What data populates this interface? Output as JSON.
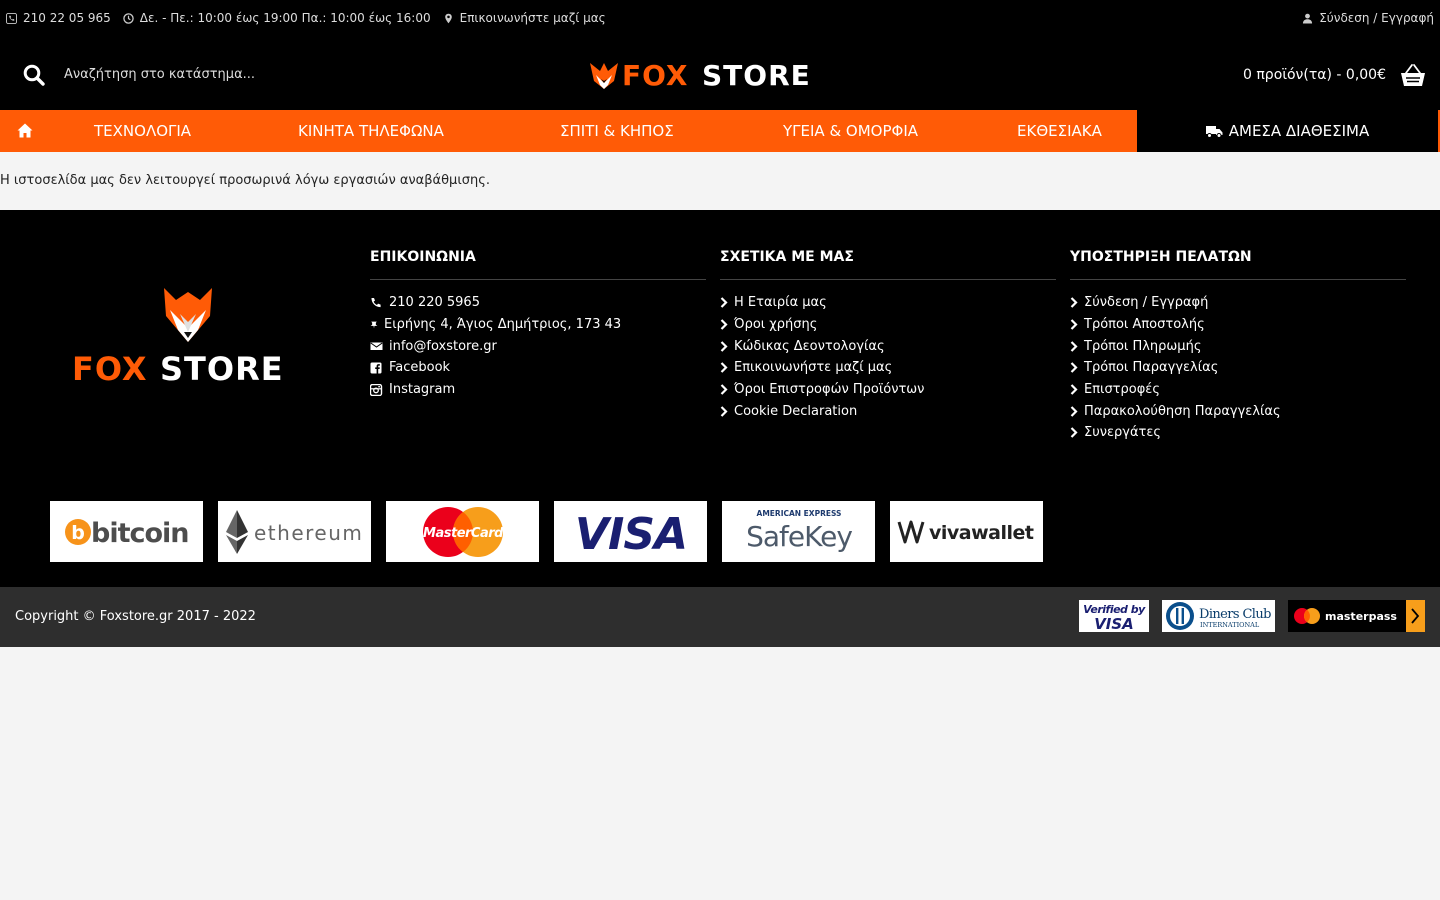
{
  "topbar": {
    "phone": "210 22 05 965",
    "hours": "Δε. - Πε.: 10:00 έως 19:00 Πα.: 10:00 έως 16:00",
    "contact": "Επικοινωνήστε μαζί μας",
    "login": "Σύνδεση / Εγγραφή"
  },
  "header": {
    "search_placeholder": "Αναζήτηση στο κατάστημα...",
    "logo_left": "FOX",
    "logo_right": "STORE",
    "cart_text": "0 προϊόν(τα) - 0,00€"
  },
  "nav": {
    "items": [
      "ΤΕΧΝΟΛΟΓΙΑ",
      "ΚΙΝΗΤΑ ΤΗΛΕΦΩΝΑ",
      "ΣΠΙΤΙ & ΚΗΠΟΣ",
      "ΥΓΕΙΑ & ΟΜΟΡΦΙΑ",
      "ΕΚΘΕΣΙΑΚΑ"
    ],
    "available": "ΑΜΕΣΑ ΔΙΑΘΕΣΙΜΑ"
  },
  "notice": "Η ιστοσελίδα μας δεν λειτουργεί προσωρινά λόγω εργασιών αναβάθμισης.",
  "footer": {
    "logo_left": "FOX",
    "logo_right": "STORE",
    "contact": {
      "title": "ΕΠΙΚΟΙΝΩΝΙΑ",
      "phone": "210 220 5965",
      "address": "Ειρήνης 4, Άγιος Δημήτριος, 173 43",
      "email": "info@foxstore.gr",
      "facebook": "Facebook",
      "instagram": "Instagram"
    },
    "about": {
      "title": "ΣΧΕΤΙΚΑ ΜΕ ΜΑΣ",
      "items": [
        "Η Εταιρία μας",
        "Όροι χρήσης",
        "Κώδικας Δεοντολογίας",
        "Επικοινωνήστε μαζί μας",
        "Όροι Επιστροφών Προϊόντων",
        "Cookie Declaration"
      ]
    },
    "support": {
      "title": "ΥΠΟΣΤΗΡΙΞΗ ΠΕΛΑΤΩΝ",
      "items": [
        "Σύνδεση / Εγγραφή",
        "Τρόποι Αποστολής",
        "Τρόποι Πληρωμής",
        "Τρόποι Παραγγελίας",
        "Επιστροφές",
        "Παρακολούθηση Παραγγελίας",
        "Συνεργάτες"
      ]
    },
    "payments": {
      "bitcoin": "bitcoin",
      "ethereum": "ethereum",
      "mastercard": "MasterCard",
      "visa": "VISA",
      "amex_top": "AMERICAN EXPRESS",
      "amex_main": "SafeKey",
      "viva": "vivawallet"
    }
  },
  "bottom": {
    "copyright": "Copyright © Foxstore.gr 2017 - 2022",
    "verified_top": "Verified by",
    "verified_main": "VISA",
    "diners_top": "Diners Club",
    "diners_sub": "INTERNATIONAL",
    "masterpass": "masterpass"
  },
  "colors": {
    "accent": "#ff5b06",
    "background": "#f4f4f4",
    "footer": "#000000",
    "bottom_bar": "#2e2e2e"
  }
}
